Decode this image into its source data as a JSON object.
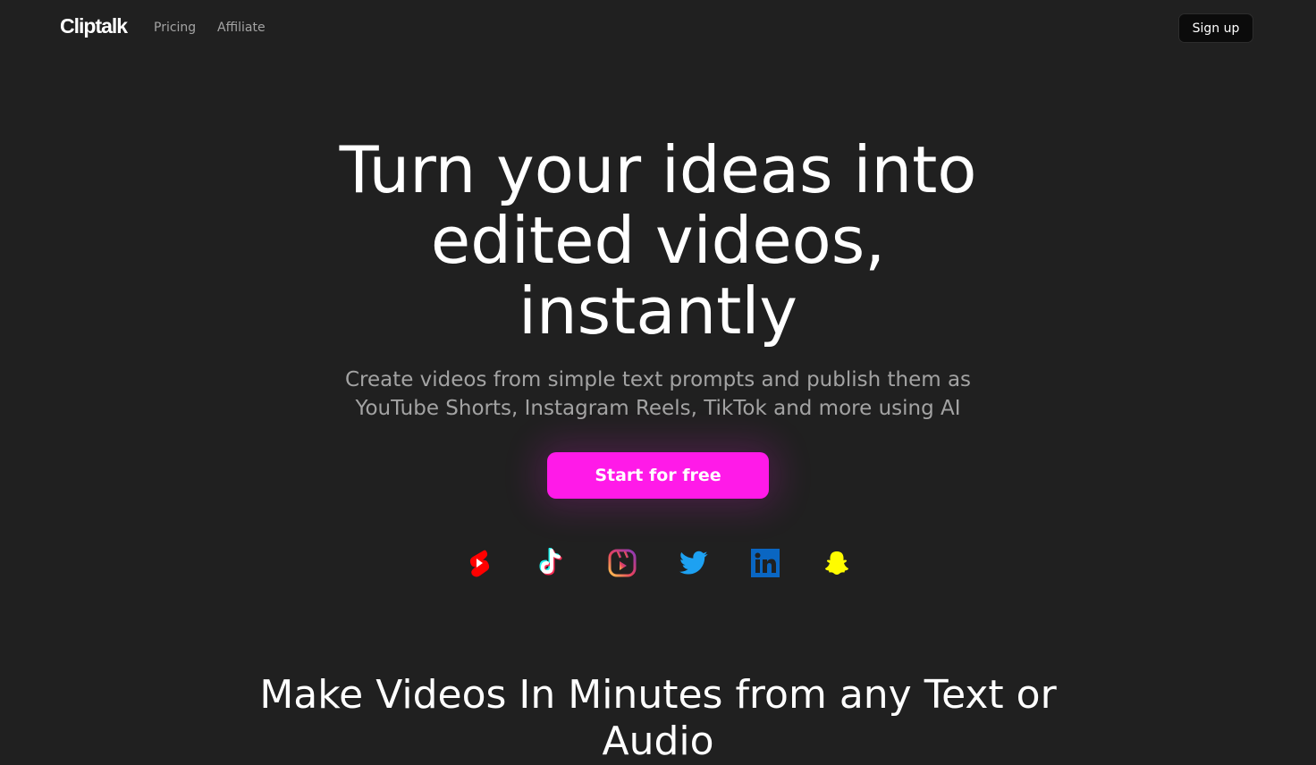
{
  "nav": {
    "logo": "Cliptalk",
    "links": [
      "Pricing",
      "Affiliate"
    ],
    "signup_label": "Sign up"
  },
  "hero": {
    "title_lines": [
      "Turn your ideas into",
      "edited videos,",
      "instantly"
    ],
    "subtitle_lines": [
      "Create videos from simple text prompts and publish them as",
      "YouTube Shorts, Instagram Reels, TikTok and more using AI"
    ],
    "cta_label": "Start for free"
  },
  "platforms": [
    {
      "icon": "youtube-shorts-icon",
      "color": "#ff0000"
    },
    {
      "icon": "tiktok-icon",
      "color": "#ffffff"
    },
    {
      "icon": "instagram-reels-icon",
      "color": "#e1306c"
    },
    {
      "icon": "twitter-icon",
      "color": "#1da1f2"
    },
    {
      "icon": "linkedin-icon",
      "color": "#0a66c2"
    },
    {
      "icon": "snapchat-icon",
      "color": "#fffc00"
    }
  ],
  "section": {
    "heading": "Make Videos In Minutes from any Text or Audio"
  },
  "colors": {
    "background": "#202020",
    "accent": "#ff1ae8",
    "muted_text": "#a3a3a3"
  }
}
